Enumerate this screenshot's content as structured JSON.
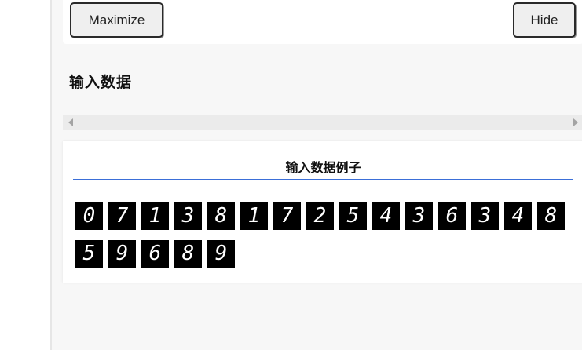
{
  "toolbar": {
    "maximize_label": "Maximize",
    "hide_label": "Hide"
  },
  "section": {
    "title": "输入数据"
  },
  "card": {
    "title": "输入数据例子",
    "digits": [
      "0",
      "7",
      "1",
      "3",
      "8",
      "1",
      "7",
      "2",
      "5",
      "4",
      "3",
      "6",
      "3",
      "4",
      "8",
      "5",
      "9",
      "6",
      "8",
      "9"
    ]
  },
  "colors": {
    "accent": "#3b6fd8",
    "background": "#f7f7f7",
    "digit_bg": "#000000",
    "digit_fg": "#ffffff"
  },
  "icons": [
    "scroll-left-arrow-icon",
    "scroll-right-arrow-icon"
  ]
}
